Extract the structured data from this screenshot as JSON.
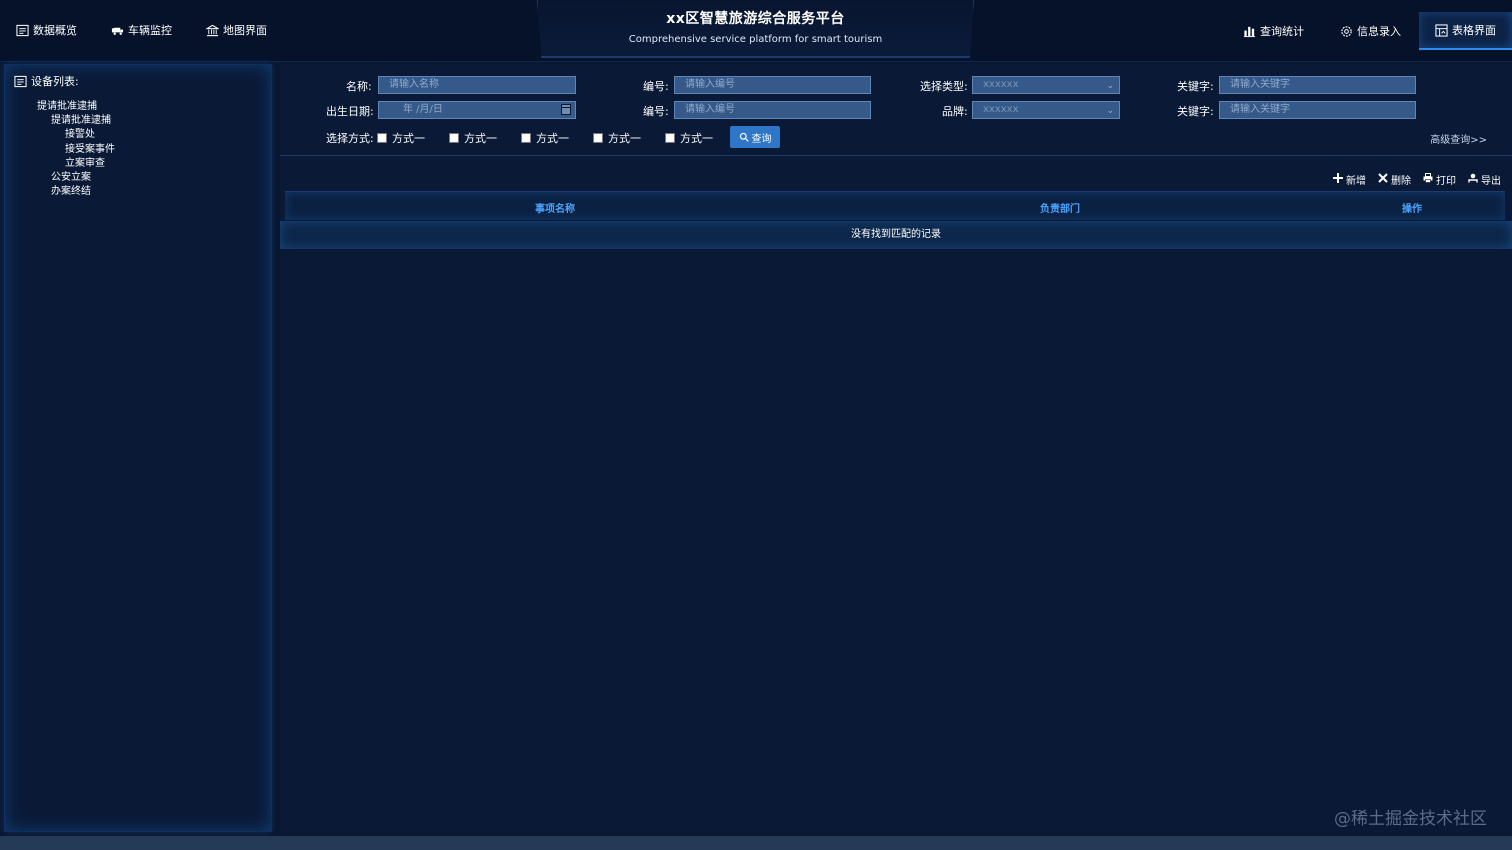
{
  "header": {
    "title_cn": "xx区智慧旅游综合服务平台",
    "title_en": "Comprehensive service platform for smart tourism",
    "nav_left": [
      {
        "label": "数据概览",
        "icon": "document-icon"
      },
      {
        "label": "车辆监控",
        "icon": "truck-icon"
      },
      {
        "label": "地图界面",
        "icon": "building-icon"
      }
    ],
    "nav_right": [
      {
        "label": "查询统计",
        "icon": "bar-chart-icon"
      },
      {
        "label": "信息录入",
        "icon": "gear-icon"
      },
      {
        "label": "表格界面",
        "icon": "table-icon",
        "active": true
      }
    ]
  },
  "sidebar": {
    "title": "设备列表:",
    "tree": [
      {
        "label": "提请批准逮捕",
        "level": 1
      },
      {
        "label": "提请批准逮捕",
        "level": 2
      },
      {
        "label": "接警处",
        "level": 3
      },
      {
        "label": "接受案事件",
        "level": 3
      },
      {
        "label": "立案审查",
        "level": 3
      },
      {
        "label": "公安立案",
        "level": 2
      },
      {
        "label": "办案终结",
        "level": 2
      }
    ]
  },
  "filters": {
    "name_label": "名称:",
    "name_placeholder": "请输入名称",
    "code_label": "编号:",
    "code_placeholder": "请输入编号",
    "type_label": "选择类型:",
    "type_value": "xxxxxx",
    "keyword_label": "关键字:",
    "keyword_placeholder": "请输入关键字",
    "birth_label": "出生日期:",
    "birth_placeholder": "年 /月/日",
    "code2_label": "编号:",
    "code2_placeholder": "请输入编号",
    "brand_label": "品牌:",
    "brand_value": "xxxxxx",
    "keyword2_label": "关键字:",
    "keyword2_placeholder": "请输入关键字",
    "mode_label": "选择方式:",
    "modes": [
      "方式一",
      "方式一",
      "方式一",
      "方式一",
      "方式一"
    ],
    "query_button": "查询",
    "advanced_link": "高级查询>>"
  },
  "toolbar": {
    "add": "新增",
    "delete": "删除",
    "print": "打印",
    "export": "导出"
  },
  "table": {
    "columns": [
      "事项名称",
      "负责部门",
      "操作"
    ],
    "empty_text": "没有找到匹配的记录"
  },
  "watermark": "@稀土掘金技术社区",
  "colors": {
    "background": "#0a1730",
    "accent": "#2b8bf2",
    "header_text": "#4aa3ff",
    "input_bg": "#355a89"
  }
}
